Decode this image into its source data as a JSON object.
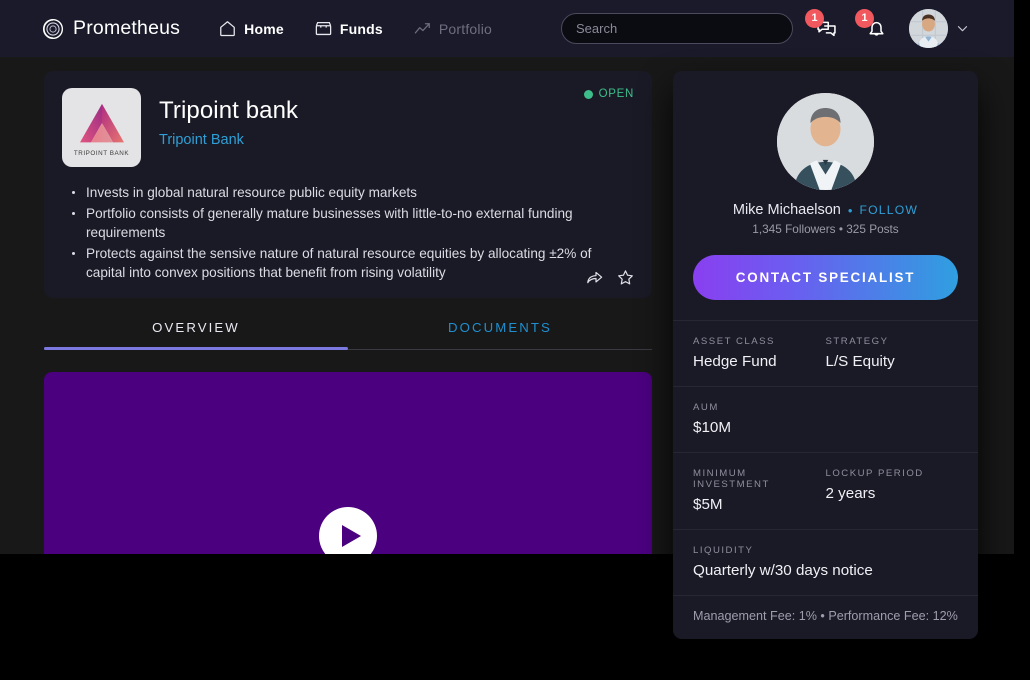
{
  "header": {
    "brand": "Prometheus",
    "nav": [
      {
        "label": "Home",
        "icon": "home-icon",
        "active": true
      },
      {
        "label": "Funds",
        "icon": "store-icon",
        "active": true
      },
      {
        "label": "Portfolio",
        "icon": "chart-line-icon",
        "active": false
      }
    ],
    "search": {
      "placeholder": "Search",
      "value": ""
    },
    "messages_badge": "1",
    "notifications_badge": "1"
  },
  "fund": {
    "logo_text": "TRIPOINT BANK",
    "name": "Tripoint bank",
    "subtitle": "Tripoint Bank",
    "status": "OPEN",
    "status_color": "#3dbd8a",
    "bullets": [
      "Invests in global natural resource public equity markets",
      "Portfolio consists of generally mature businesses with little-to-no external funding requirements",
      "Protects against the sensive nature of natural resource equities by allocating ±2% of capital into convex positions that benefit from rising volatility"
    ]
  },
  "tabs": [
    {
      "label": "OVERVIEW",
      "active": true
    },
    {
      "label": "DOCUMENTS",
      "active": false
    }
  ],
  "video": {
    "accent": "#4b0080"
  },
  "specialist": {
    "name": "Mike Michaelson",
    "follow_label": "FOLLOW",
    "meta": "1,345 Followers • 325 Posts",
    "contact_label": "CONTACT SPECIALIST"
  },
  "specs": [
    [
      {
        "label": "ASSET CLASS",
        "value": "Hedge Fund"
      },
      {
        "label": "STRATEGY",
        "value": "L/S Equity"
      }
    ],
    [
      {
        "label": "AUM",
        "value": "$10M"
      }
    ],
    [
      {
        "label": "MINIMUM INVESTMENT",
        "value": "$5M"
      },
      {
        "label": "LOCKUP PERIOD",
        "value": "2 years"
      }
    ],
    [
      {
        "label": "LIQUIDITY",
        "value": "Quarterly w/30 days notice"
      }
    ]
  ],
  "fees": "Management Fee: 1% • Performance Fee: 12%"
}
